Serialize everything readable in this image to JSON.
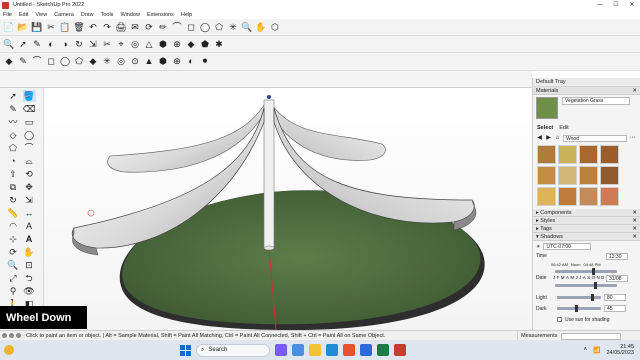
{
  "window": {
    "title": "Untitled - SketchUp Pro 2022",
    "controls": [
      "—",
      "☐",
      "✕"
    ]
  },
  "menu": [
    "File",
    "Edit",
    "View",
    "Camera",
    "Draw",
    "Tools",
    "Window",
    "Extensions",
    "Help"
  ],
  "overlay": {
    "text": "Wheel Down"
  },
  "tray": {
    "title": "Default Tray",
    "materials": {
      "header": "Materials",
      "current_name": "Vegetation Grass",
      "tabs": [
        "Select",
        "Edit"
      ],
      "collection": "Wood",
      "swatches": [
        "#b07a3a",
        "#c9b25a",
        "#a8682f",
        "#9c5d2a",
        "#c58a45",
        "#d2b878",
        "#b8813f",
        "#8e5a2c",
        "#e0b35a",
        "#bf7b3a",
        "#c28b5c",
        "#d07a55"
      ]
    },
    "collapsed": [
      "Components",
      "Styles",
      "Tags"
    ],
    "shadows": {
      "header": "Shadows",
      "timezone": "UTC-07:00",
      "time_label": "Time",
      "time_start": "06:42 AM",
      "time_noon": "Noon",
      "time_end": "04:48 PM",
      "time_value": "13:30",
      "time_fraction": 0.62,
      "date_label": "Date",
      "months": [
        "J",
        "F",
        "M",
        "A",
        "M",
        "J",
        "J",
        "A",
        "S",
        "O",
        "N",
        "D"
      ],
      "date_value": "31/08",
      "date_fraction": 0.66,
      "light_label": "Light",
      "light_value": "80",
      "light_fraction": 0.8,
      "dark_label": "Dark",
      "dark_value": "45",
      "dark_fraction": 0.45,
      "use_sun_label": "Use sun for shading"
    }
  },
  "status": {
    "hint": "Click to paint an item or object. | Alt = Sample Material, Shift = Paint All Matching, Ctrl = Paint All Connected, Shift + Ctrl = Paint All on Same Object.",
    "measurements_label": "Measurements"
  },
  "taskbar": {
    "search_placeholder": "Search",
    "time": "21:45",
    "date": "24/05/2023"
  },
  "toolbar_icons": {
    "row1": [
      "📄",
      "📂",
      "💾",
      "✂",
      "📋",
      "🗑",
      "↶",
      "↷",
      "🖨",
      "✉",
      "⟳",
      "✏",
      "⌒",
      "◻",
      "◯",
      "⬠",
      "✳",
      "🔍",
      "✋",
      "⬡"
    ],
    "row2": [
      "🔍",
      "➚",
      "✎",
      "◐",
      "◑",
      "↻",
      "⇲",
      "✂",
      "⌖",
      "◎",
      "△",
      "⬢",
      "⊕",
      "◆",
      "⬟",
      "✱"
    ],
    "row3": [
      "◆",
      "✎",
      "⌒",
      "◻",
      "◯",
      "⬠",
      "◆",
      "✳",
      "◎",
      "⊙",
      "▲",
      "⬢",
      "⊕",
      "◐",
      "⚫"
    ]
  },
  "colors": {
    "accent": "#1b6ac9",
    "ground": "#4a6a3a",
    "sky": "#ffffff",
    "axis_red": "#c0392b",
    "axis_blue": "#2c3e9e",
    "axis_green": "#3a8a3a"
  }
}
